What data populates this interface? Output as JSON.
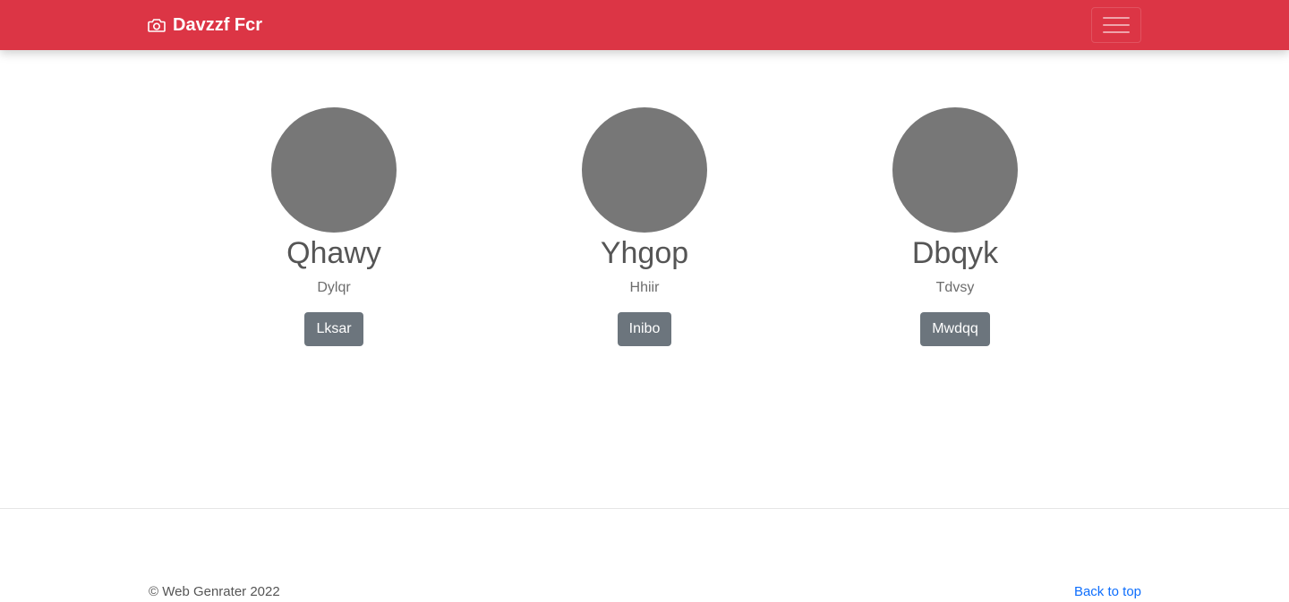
{
  "navbar": {
    "brand_text": "Davzzf Fcr",
    "brand_icon": "camera-icon",
    "toggler_icon": "hamburger-menu-icon",
    "background_color": "#dc3545"
  },
  "cards": [
    {
      "name": "Qhawy",
      "subtitle": "Dylqr",
      "button_label": "Lksar"
    },
    {
      "name": "Yhgop",
      "subtitle": "Hhiir",
      "button_label": "Inibo"
    },
    {
      "name": "Dbqyk",
      "subtitle": "Tdvsy",
      "button_label": "Mwdqq"
    }
  ],
  "footer": {
    "copyright": "© Web Genrater 2022",
    "back_to_top": "Back to top"
  }
}
